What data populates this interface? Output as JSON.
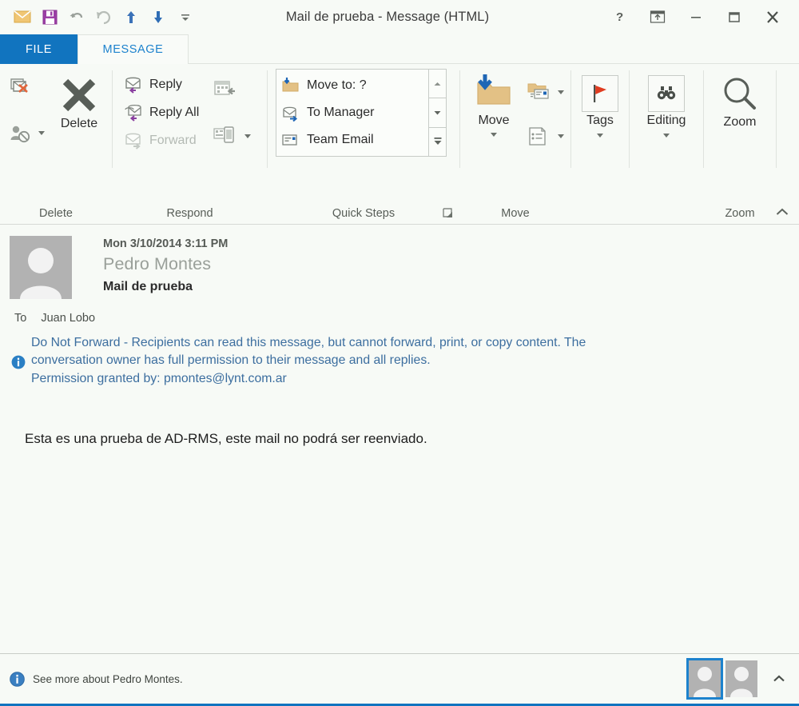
{
  "window": {
    "title": "Mail de prueba - Message (HTML)",
    "quick_access": [
      {
        "name": "envelope-icon",
        "tip": "Mail"
      },
      {
        "name": "save-icon",
        "tip": "Save"
      },
      {
        "name": "undo-icon",
        "tip": "Undo"
      },
      {
        "name": "redo-icon",
        "tip": "Redo"
      },
      {
        "name": "previous-item-icon",
        "tip": "Previous Item"
      },
      {
        "name": "next-item-icon",
        "tip": "Next Item"
      },
      {
        "name": "customize-quick-access-toolbar-icon",
        "tip": "Customize Quick Access Toolbar"
      }
    ],
    "controls": [
      {
        "name": "help-button",
        "glyph": "?"
      },
      {
        "name": "ribbon-display-options-button",
        "glyph": "ribbon"
      },
      {
        "name": "minimize-button",
        "glyph": "minimize"
      },
      {
        "name": "maximize-button",
        "glyph": "maximize"
      },
      {
        "name": "close-button",
        "glyph": "close"
      }
    ]
  },
  "tabs": {
    "file": "FILE",
    "message": "MESSAGE",
    "active": "MESSAGE"
  },
  "ribbon": {
    "groups": {
      "delete": {
        "label": "Delete",
        "ignore_label": "",
        "junk_label": "",
        "delete_label": "Delete"
      },
      "respond": {
        "label": "Respond",
        "reply": "Reply",
        "reply_all": "Reply All",
        "forward": "Forward",
        "meeting_label": "",
        "more_label": ""
      },
      "quick_steps": {
        "label": "Quick Steps",
        "items": [
          {
            "label": "Move to: ?",
            "icon": "move-to-folder-icon"
          },
          {
            "label": "To Manager",
            "icon": "to-manager-icon"
          },
          {
            "label": "Team Email",
            "icon": "team-email-icon"
          }
        ]
      },
      "move": {
        "label": "Move",
        "move_label": "Move",
        "rules_label": "",
        "onenote_label": ""
      },
      "tags": {
        "label": "",
        "tags_label": "Tags"
      },
      "editing": {
        "label": "",
        "editing_label": "Editing"
      },
      "zoom": {
        "label": "Zoom",
        "zoom_label": "Zoom"
      }
    }
  },
  "message": {
    "date": "Mon 3/10/2014 3:11 PM",
    "sender": "Pedro Montes",
    "subject": "Mail de prueba",
    "to_label": "To",
    "to_value": "Juan Lobo",
    "permission_line1": "Do Not Forward - Recipients can read this message, but cannot forward, print, or copy content. The",
    "permission_line2": "conversation owner has full permission to their message and all replies.",
    "permission_line3": "Permission granted by: pmontes@lynt.com.ar",
    "body": "Esta es una prueba de AD-RMS, este mail no podrá ser reenviado."
  },
  "status": {
    "text": "See more about Pedro Montes.",
    "info_icon": "info-icon"
  },
  "colors": {
    "file_tab": "#1174bf",
    "accent": "#1d82cd",
    "permission_text": "#3c6e9f",
    "ribbon_bg": "#f7faf6",
    "body_bg": "#f7faf6"
  }
}
